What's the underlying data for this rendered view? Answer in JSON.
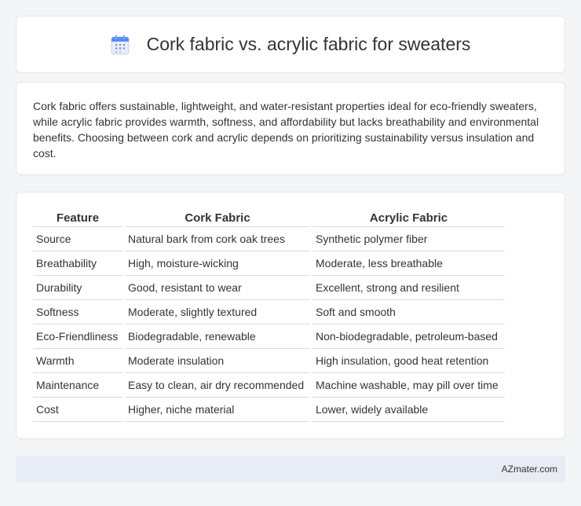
{
  "header": {
    "title": "Cork fabric vs. acrylic fabric for sweaters",
    "icon": "calendar-icon"
  },
  "intro": {
    "text": "Cork fabric offers sustainable, lightweight, and water-resistant properties ideal for eco-friendly sweaters, while acrylic fabric provides warmth, softness, and affordability but lacks breathability and environmental benefits. Choosing between cork and acrylic depends on prioritizing sustainability versus insulation and cost."
  },
  "table": {
    "headers": [
      "Feature",
      "Cork Fabric",
      "Acrylic Fabric"
    ],
    "rows": [
      [
        "Source",
        "Natural bark from cork oak trees",
        "Synthetic polymer fiber"
      ],
      [
        "Breathability",
        "High, moisture-wicking",
        "Moderate, less breathable"
      ],
      [
        "Durability",
        "Good, resistant to wear",
        "Excellent, strong and resilient"
      ],
      [
        "Softness",
        "Moderate, slightly textured",
        "Soft and smooth"
      ],
      [
        "Eco-Friendliness",
        "Biodegradable, renewable",
        "Non-biodegradable, petroleum-based"
      ],
      [
        "Warmth",
        "Moderate insulation",
        "High insulation, good heat retention"
      ],
      [
        "Maintenance",
        "Easy to clean, air dry recommended",
        "Machine washable, may pill over time"
      ],
      [
        "Cost",
        "Higher, niche material",
        "Lower, widely available"
      ]
    ]
  },
  "footer": {
    "brand": "AZmater.com"
  },
  "colors": {
    "background": "#f4f5f7",
    "card": "#ffffff",
    "footer": "#e8ecf4",
    "icon_accent": "#5b8def"
  }
}
